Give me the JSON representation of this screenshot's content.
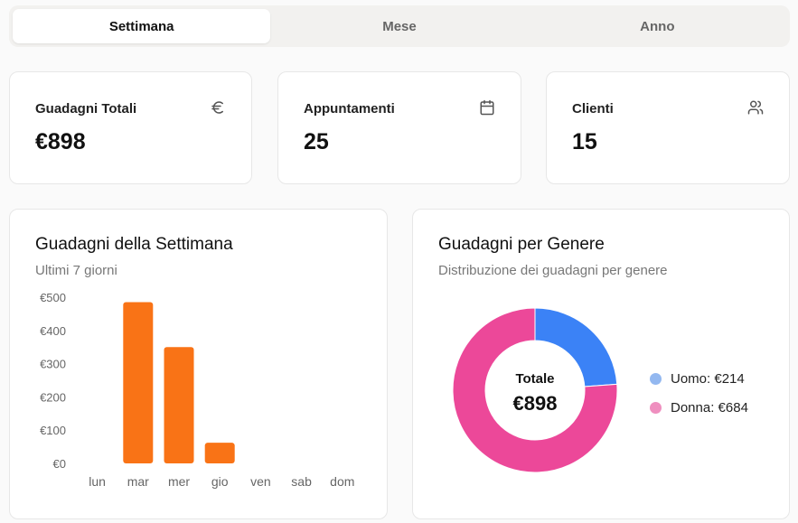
{
  "tabs": [
    {
      "label": "Settimana",
      "active": true
    },
    {
      "label": "Mese",
      "active": false
    },
    {
      "label": "Anno",
      "active": false
    }
  ],
  "stats": [
    {
      "label": "Guadagni Totali",
      "value": "€898",
      "icon": "euro-icon"
    },
    {
      "label": "Appuntamenti",
      "value": "25",
      "icon": "calendar-icon"
    },
    {
      "label": "Clienti",
      "value": "15",
      "icon": "users-icon"
    }
  ],
  "weekly": {
    "title": "Guadagni della Settimana",
    "subtitle": "Ultimi 7 giorni"
  },
  "gender": {
    "title": "Guadagni per Genere",
    "subtitle": "Distribuzione dei guadagni per genere",
    "center_label": "Totale",
    "center_value": "€898",
    "legend": [
      {
        "label": "Uomo: €214",
        "color": "#93b8f0"
      },
      {
        "label": "Donna: €684",
        "color": "#ef8fbf"
      }
    ]
  },
  "chart_data": [
    {
      "type": "bar",
      "categories": [
        "lun",
        "mar",
        "mer",
        "gio",
        "ven",
        "sab",
        "dom"
      ],
      "values": [
        0,
        485,
        350,
        62,
        0,
        0,
        0
      ],
      "ylim": [
        0,
        500
      ],
      "yticks": [
        "€0",
        "€100",
        "€200",
        "€300",
        "€400",
        "€500"
      ],
      "ytick_values": [
        0,
        100,
        200,
        300,
        400,
        500
      ],
      "color": "#f97316",
      "grid": false
    },
    {
      "type": "pie",
      "donut": true,
      "categories": [
        "Uomo",
        "Donna"
      ],
      "values": [
        214,
        684
      ],
      "colors": [
        "#3b82f6",
        "#ec4899"
      ]
    }
  ]
}
